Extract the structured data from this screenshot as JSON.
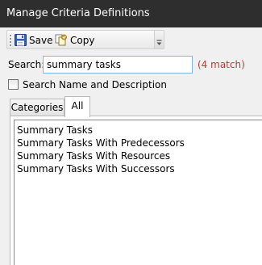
{
  "window": {
    "title": "Manage Criteria Definitions"
  },
  "toolbar": {
    "save_label": "Save",
    "copy_label": "Copy",
    "save_icon": "floppy-disk-icon",
    "copy_icon": "copy-icon"
  },
  "search": {
    "label": "Search:",
    "value": "summary tasks",
    "match_text": "(4 match)"
  },
  "options": {
    "search_name_desc_label": "Search Name and Description",
    "search_name_desc_checked": false
  },
  "tabs": [
    {
      "label": "Categories",
      "selected": false
    },
    {
      "label": "All",
      "selected": true
    }
  ],
  "results": [
    "Summary Tasks",
    "Summary Tasks With Predecessors",
    "Summary Tasks With Resources",
    "Summary Tasks With Successors"
  ],
  "colors": {
    "titlebar_bg": "#2e2e2e",
    "match_text": "#c0393b",
    "input_border": "#7eb4ea"
  }
}
